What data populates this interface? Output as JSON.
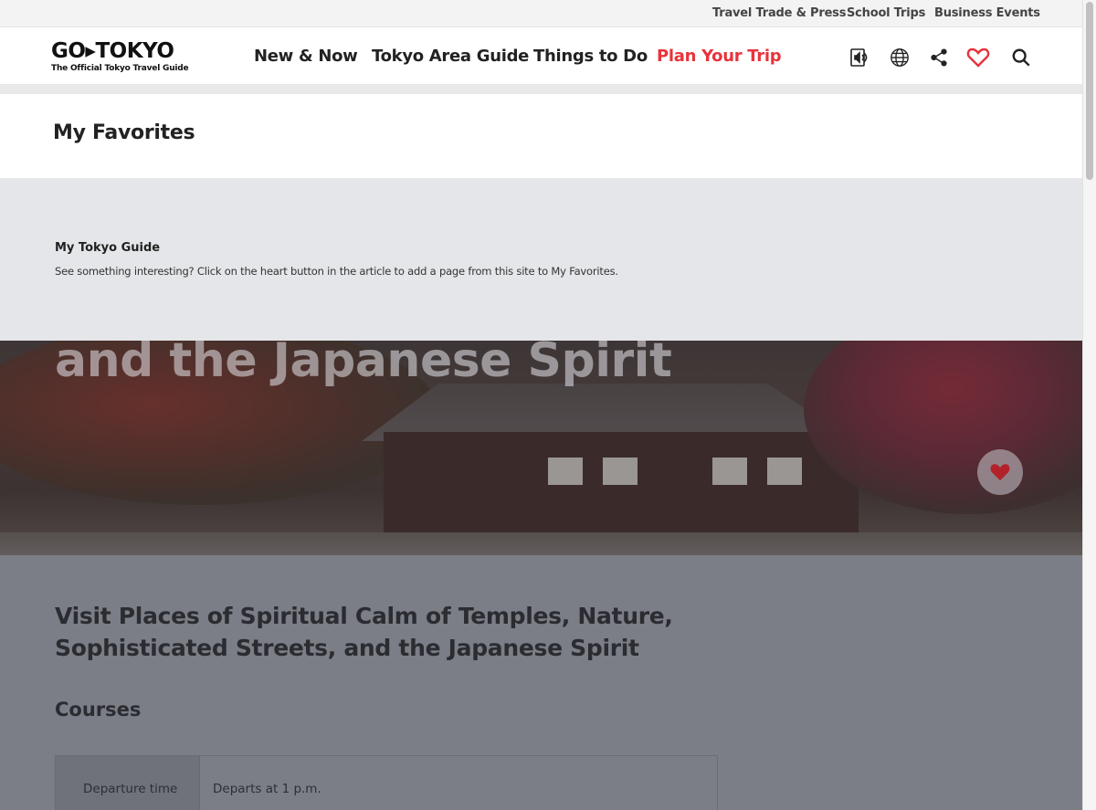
{
  "utility_nav": {
    "items": [
      {
        "label": "Travel Trade & Press"
      },
      {
        "label": "School Trips"
      },
      {
        "label": "Business Events"
      }
    ]
  },
  "header": {
    "logo": {
      "main": "GO▸TOKYO",
      "tagline": "The Official Tokyo Travel Guide"
    },
    "nav": [
      {
        "label": "New & Now"
      },
      {
        "label": "Tokyo Area Guide"
      },
      {
        "label": "Things to Do"
      },
      {
        "label": "Plan Your Trip",
        "active": true
      }
    ],
    "icons": [
      "audio-guide-icon",
      "globe-icon",
      "share-icon",
      "heart-icon",
      "search-icon"
    ]
  },
  "page": {
    "title": "My Favorites"
  },
  "favorites_panel": {
    "heading": "My Tokyo Guide",
    "description": "See something interesting? Click on the heart button in the article to add a page from this site to My Favorites."
  },
  "hero": {
    "title": "and the Japanese Spirit"
  },
  "article": {
    "title": "Visit Places of Spiritual Calm of Temples, Nature, Sophisticated Streets, and the Japanese Spirit",
    "courses_heading": "Courses",
    "course_table": {
      "rows": [
        {
          "label": "Departure time",
          "value": "Departs at 1 p.m."
        }
      ]
    }
  },
  "colors": {
    "accent": "#e8333c",
    "overlay": "#7b7e86",
    "panel": "#e5e6e9"
  }
}
